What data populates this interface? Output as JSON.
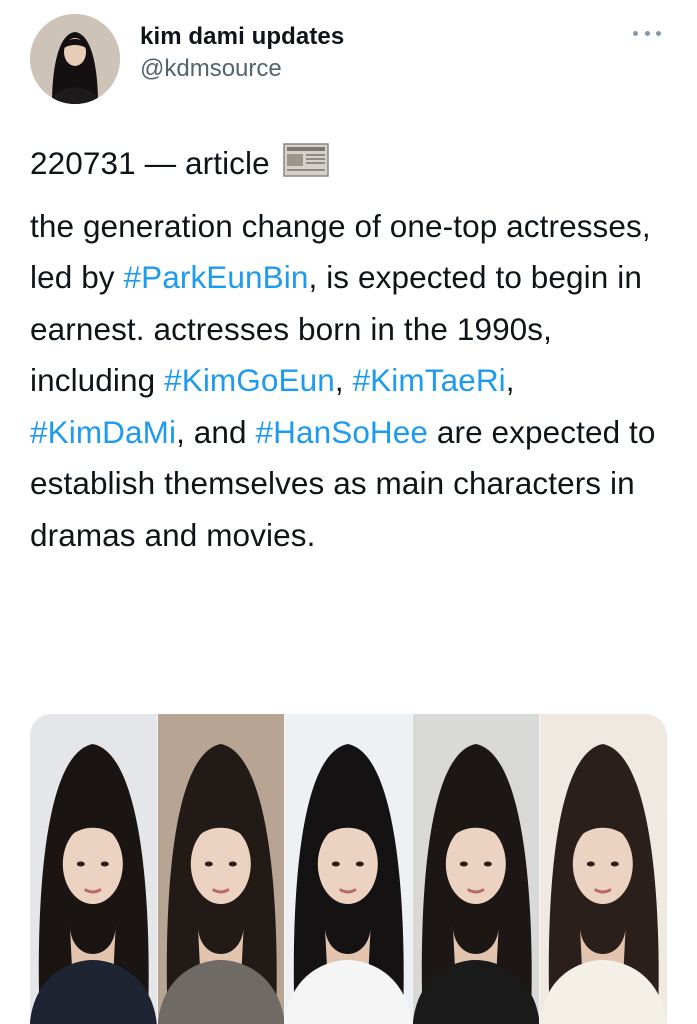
{
  "tweet": {
    "display_name": "kim dami updates",
    "handle": "@kdmsource",
    "more_icon": "more-horizontal-icon",
    "dateline": "220731 — article",
    "dateline_icon": "newspaper-icon",
    "text": {
      "p1": "the generation change of one-top actresses, led by ",
      "tag1": "#ParkEunBin",
      "p2": ", is expected to begin in earnest. actresses born in the 1990s, including ",
      "tag2": "#KimGoEun",
      "p3": ", ",
      "tag3": "#KimTaeRi",
      "p4": ", ",
      "tag4": "#KimDaMi",
      "p5": ", and ",
      "tag5": "#HanSoHee",
      "p6": " are expected to establish themselves as main characters in dramas and movies."
    },
    "hashtag_color": "#1d9bf0",
    "media": {
      "portraits": [
        {
          "bg": "#e4e6ea",
          "hair": "#1a1413",
          "top": "#1f2433"
        },
        {
          "bg": "#b7a493",
          "hair": "#221a16",
          "top": "#6f6a66"
        },
        {
          "bg": "#eef1f4",
          "hair": "#141212",
          "top": "#f5f5f5"
        },
        {
          "bg": "#d9d9d7",
          "hair": "#1c1614",
          "top": "#1a1a1a"
        },
        {
          "bg": "#efe9e2",
          "hair": "#2a1f1b",
          "top": "#f4efe7"
        }
      ]
    }
  }
}
